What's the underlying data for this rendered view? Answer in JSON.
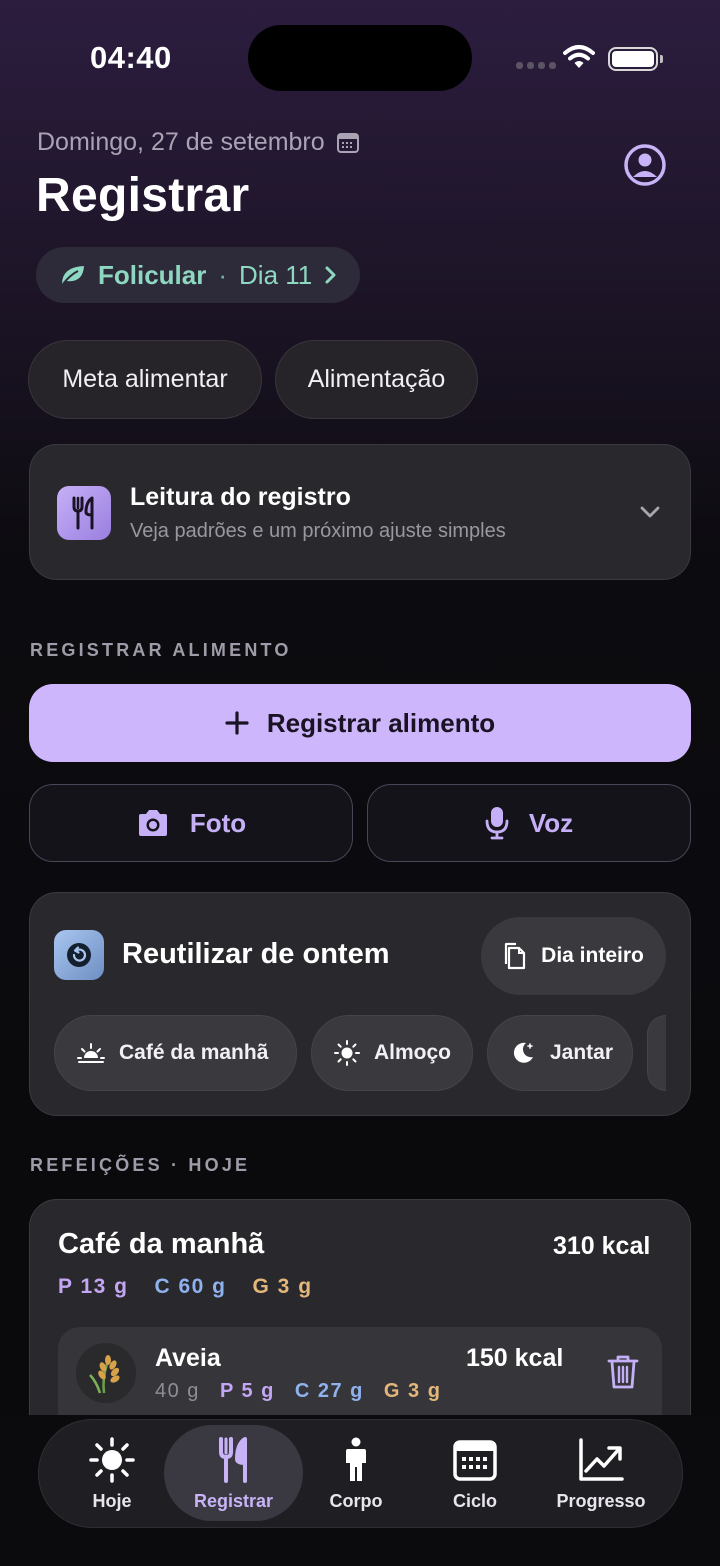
{
  "status": {
    "time": "04:40"
  },
  "header": {
    "date": "Domingo, 27 de setembro",
    "title": "Registrar"
  },
  "phase": {
    "name": "Folicular",
    "separator": "·",
    "day": "Dia 11"
  },
  "chips": [
    "Meta alimentar",
    "Alimentação"
  ],
  "insight": {
    "title": "Leitura do registro",
    "subtitle": "Veja padrões e um próximo ajuste simples"
  },
  "log_section": {
    "heading": "REGISTRAR ALIMENTO",
    "primary_label": "Registrar alimento",
    "photo_label": "Foto",
    "voice_label": "Voz"
  },
  "reuse": {
    "title": "Reutilizar de ontem",
    "whole_day_label": "Dia inteiro",
    "meals": [
      "Café da manhã",
      "Almoço",
      "Jantar"
    ]
  },
  "meals_section": {
    "heading": "REFEIÇÕES · HOJE",
    "meal": {
      "name": "Café da manhã",
      "kcal": "310 kcal",
      "protein": "P 13 g",
      "carbs": "C 60 g",
      "fat": "G 3 g",
      "item": {
        "name": "Aveia",
        "kcal": "150 kcal",
        "weight": "40 g",
        "protein": "P 5 g",
        "carbs": "C 27 g",
        "fat": "G 3 g"
      }
    }
  },
  "tabs": [
    "Hoje",
    "Registrar",
    "Corpo",
    "Ciclo",
    "Progresso"
  ],
  "colors": {
    "accent": "#cdb6fb",
    "phase": "#8ed8c2",
    "protein": "#c4a7f4",
    "carbs": "#8fb2ee",
    "fat": "#e2b779"
  }
}
